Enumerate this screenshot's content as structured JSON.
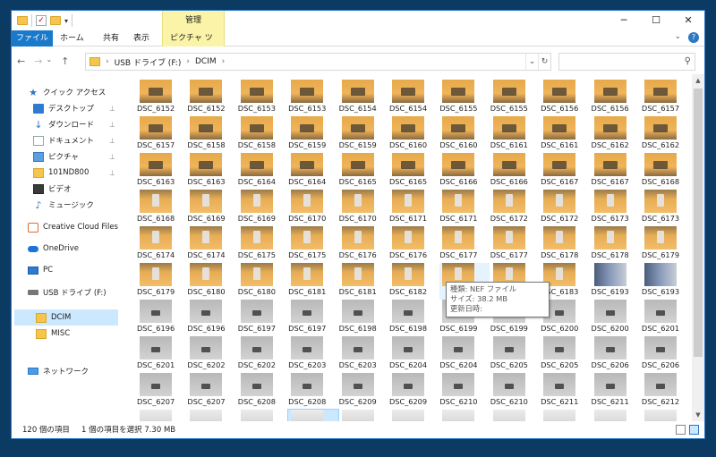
{
  "window": {
    "manage_tab": "管理",
    "controls": {
      "minimize": "─",
      "maximize": "☐",
      "close": "✕"
    }
  },
  "ribbon": {
    "tabs": [
      "ファイル",
      "ホーム",
      "共有",
      "表示",
      "ピクチャ ツール"
    ],
    "expand": "⌄",
    "help": "?"
  },
  "address": {
    "back": "←",
    "forward": "→",
    "recent": "⌄",
    "up": "↑",
    "path": [
      "USB ドライブ (F:)",
      "DCIM"
    ],
    "separator": "›",
    "dropdown": "⌄",
    "refresh": "↻",
    "search_placeholder": "",
    "search_icon": "⚲"
  },
  "sidebar": {
    "items": [
      {
        "label": "クイック アクセス",
        "icon": "star-icon",
        "pinned": false
      },
      {
        "label": "デスクトップ",
        "icon": "desktop-icon",
        "pinned": true
      },
      {
        "label": "ダウンロード",
        "icon": "download-icon",
        "pinned": true
      },
      {
        "label": "ドキュメント",
        "icon": "document-icon",
        "pinned": true
      },
      {
        "label": "ピクチャ",
        "icon": "pictures-icon",
        "pinned": true
      },
      {
        "label": "101ND800",
        "icon": "folder-icon",
        "pinned": true
      },
      {
        "label": "ビデオ",
        "icon": "video-icon",
        "pinned": false
      },
      {
        "label": "ミュージック",
        "icon": "music-icon",
        "pinned": false
      },
      {
        "label": "Creative Cloud Files",
        "icon": "creative-cloud-icon",
        "pinned": false
      },
      {
        "label": "OneDrive",
        "icon": "onedrive-icon",
        "pinned": false
      },
      {
        "label": "PC",
        "icon": "pc-icon",
        "pinned": false
      },
      {
        "label": "USB ドライブ (F:)",
        "icon": "usb-drive-icon",
        "pinned": false
      },
      {
        "label": "DCIM",
        "icon": "folder-icon",
        "pinned": false,
        "selected": true
      },
      {
        "label": "MISC",
        "icon": "folder-icon",
        "pinned": false
      },
      {
        "label": "ネットワーク",
        "icon": "network-icon",
        "pinned": false
      }
    ],
    "pin_glyph": "📌"
  },
  "files": [
    "DSC_6152",
    "DSC_6152",
    "DSC_6153",
    "DSC_6153",
    "DSC_6154",
    "DSC_6154",
    "DSC_6155",
    "DSC_6155",
    "DSC_6156",
    "DSC_6156",
    "DSC_6157",
    "DSC_6157",
    "DSC_6158",
    "DSC_6158",
    "DSC_6159",
    "DSC_6159",
    "DSC_6160",
    "DSC_6160",
    "DSC_6161",
    "DSC_6161",
    "DSC_6162",
    "DSC_6162",
    "DSC_6163",
    "DSC_6163",
    "DSC_6164",
    "DSC_6164",
    "DSC_6165",
    "DSC_6165",
    "DSC_6166",
    "DSC_6166",
    "DSC_6167",
    "DSC_6167",
    "DSC_6168",
    "DSC_6168",
    "DSC_6169",
    "DSC_6169",
    "DSC_6170",
    "DSC_6170",
    "DSC_6171",
    "DSC_6171",
    "DSC_6172",
    "DSC_6172",
    "DSC_6173",
    "DSC_6173",
    "DSC_6174",
    "DSC_6174",
    "DSC_6175",
    "DSC_6175",
    "DSC_6176",
    "DSC_6176",
    "DSC_6177",
    "DSC_6177",
    "DSC_6178",
    "DSC_6178",
    "DSC_6179",
    "DSC_6179",
    "DSC_6180",
    "DSC_6180",
    "DSC_6181",
    "DSC_6181",
    "DSC_6182",
    "",
    "",
    "DSC_6183",
    "DSC_6193",
    "DSC_6193",
    "DSC_6196",
    "DSC_6196",
    "DSC_6197",
    "DSC_6197",
    "DSC_6198",
    "DSC_6198",
    "DSC_6199",
    "DSC_6199",
    "DSC_6200",
    "DSC_6200",
    "DSC_6201",
    "DSC_6201",
    "DSC_6202",
    "DSC_6202",
    "DSC_6203",
    "DSC_6203",
    "DSC_6204",
    "DSC_6204",
    "DSC_6205",
    "DSC_6205",
    "DSC_6206",
    "DSC_6206",
    "DSC_6207",
    "DSC_6207",
    "DSC_6208",
    "DSC_6208",
    "DSC_6209",
    "DSC_6209",
    "DSC_6210",
    "DSC_6210",
    "DSC_6211",
    "DSC_6211",
    "DSC_6212",
    "",
    "",
    "",
    "",
    "",
    "",
    "",
    "",
    "",
    "",
    ""
  ],
  "selected_index": 102,
  "tooltip": {
    "line1": "種類: NEF ファイル",
    "line2": "サイズ: 38.2 MB",
    "line3": "更新日時:"
  },
  "status": {
    "count": "120 個の項目",
    "selection": "1 個の項目を選択  7.30 MB"
  },
  "scrollbar": {
    "up": "▲",
    "down": "▼"
  }
}
